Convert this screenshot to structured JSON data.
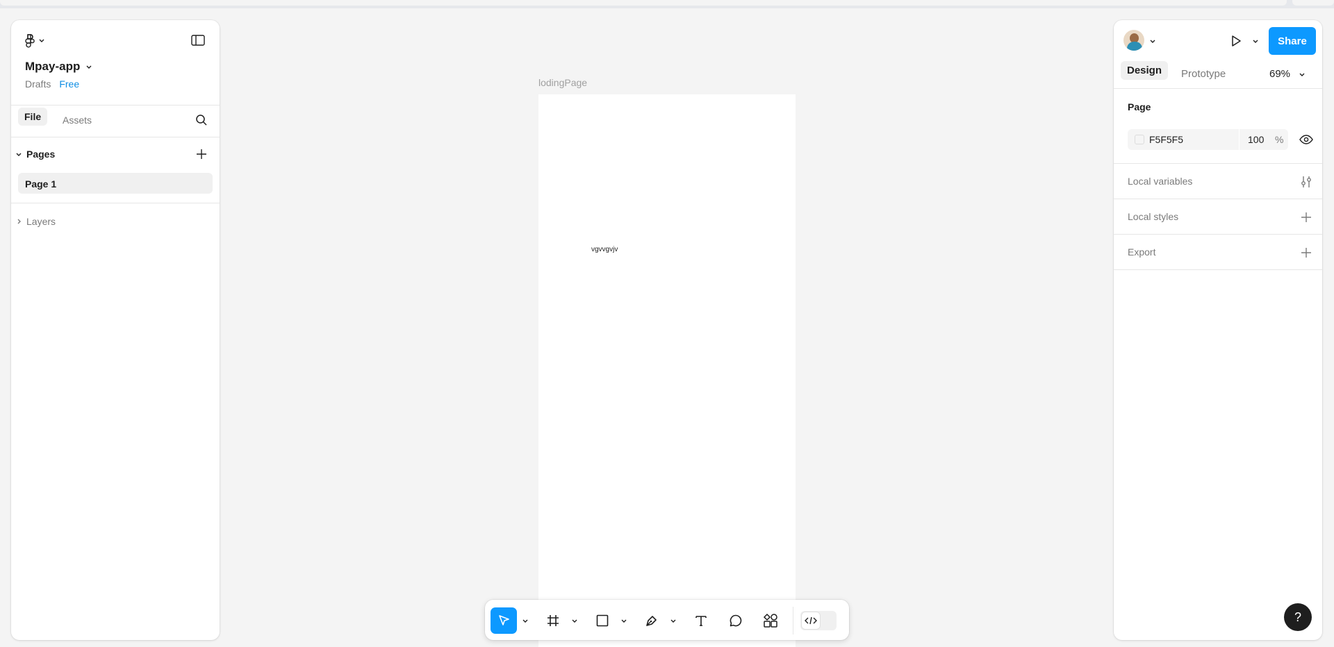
{
  "app": {
    "file_name": "Mpay-app",
    "location": "Drafts",
    "plan_badge": "Free"
  },
  "left_panel": {
    "tabs": [
      {
        "label": "File",
        "active": true
      },
      {
        "label": "Assets",
        "active": false
      }
    ],
    "pages_title": "Pages",
    "pages": [
      {
        "label": "Page 1",
        "selected": true
      }
    ],
    "layers_title": "Layers"
  },
  "canvas": {
    "frame_name": "lodingPage",
    "frame_text": "vgvvgvjv",
    "background": "#f4f4f4"
  },
  "toolbar": {
    "tools": [
      {
        "icon": "move-cursor-icon",
        "active": true,
        "has_dropdown": true
      },
      {
        "icon": "frame-hash-icon",
        "active": false,
        "has_dropdown": true
      },
      {
        "icon": "rectangle-icon",
        "active": false,
        "has_dropdown": true
      },
      {
        "icon": "pen-icon",
        "active": false,
        "has_dropdown": true
      },
      {
        "icon": "text-icon",
        "active": false,
        "has_dropdown": false
      },
      {
        "icon": "comment-icon",
        "active": false,
        "has_dropdown": false
      },
      {
        "icon": "actions-icon",
        "active": false,
        "has_dropdown": false
      },
      {
        "icon": "dev-mode-icon",
        "active": false,
        "has_dropdown": false
      }
    ]
  },
  "right_panel": {
    "share_label": "Share",
    "tabs": [
      {
        "label": "Design",
        "active": true
      },
      {
        "label": "Prototype",
        "active": false
      }
    ],
    "zoom": "69%",
    "page_section": {
      "title": "Page",
      "fill_hex": "F5F5F5",
      "opacity": "100",
      "opacity_unit": "%"
    },
    "local_variables_label": "Local variables",
    "local_styles_label": "Local styles",
    "export_label": "Export"
  },
  "help_label": "?",
  "colors": {
    "accent": "#0d99ff",
    "badge_blue": "#0d8de3",
    "page_fill": "#F5F5F5"
  }
}
